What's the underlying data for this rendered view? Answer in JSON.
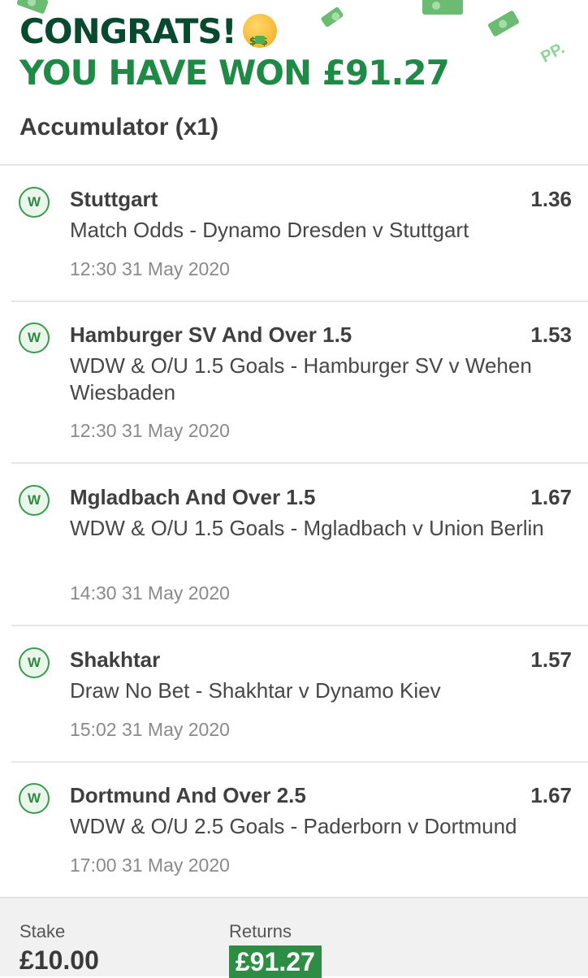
{
  "banner": {
    "congrats": "CONGRATS!",
    "won": "YOU HAVE WON £91.27",
    "emoji": "money-mouth-face",
    "brand_mark": "PP."
  },
  "bet": {
    "title": "Accumulator (x1)"
  },
  "selections": [
    {
      "result": "W",
      "name": "Stuttgart",
      "odds": "1.36",
      "market": "Match Odds - Dynamo Dresden v Stuttgart",
      "time": "12:30 31 May 2020"
    },
    {
      "result": "W",
      "name": "Hamburger SV And Over 1.5",
      "odds": "1.53",
      "market": "WDW & O/U 1.5 Goals - Hamburger SV v Wehen Wiesbaden",
      "time": "12:30 31 May 2020"
    },
    {
      "result": "W",
      "name": "Mgladbach And Over 1.5",
      "odds": "1.67",
      "market": "WDW & O/U 1.5 Goals - Mgladbach v Union Berlin",
      "time": "14:30 31 May 2020"
    },
    {
      "result": "W",
      "name": "Shakhtar",
      "odds": "1.57",
      "market": "Draw No Bet - Shakhtar v Dynamo Kiev",
      "time": "15:02 31 May 2020"
    },
    {
      "result": "W",
      "name": "Dortmund And Over 2.5",
      "odds": "1.67",
      "market": "WDW & O/U 2.5 Goals - Paderborn v Dortmund",
      "time": "17:00 31 May 2020"
    }
  ],
  "footer": {
    "stake_label": "Stake",
    "stake_value": "£10.00",
    "returns_label": "Returns",
    "returns_value": "£91.27"
  },
  "colors": {
    "congrats_text": "#074a30",
    "won_text": "#1f8a45",
    "win_badge": "#3a9a4e",
    "returns_bg": "#2e8d45"
  }
}
